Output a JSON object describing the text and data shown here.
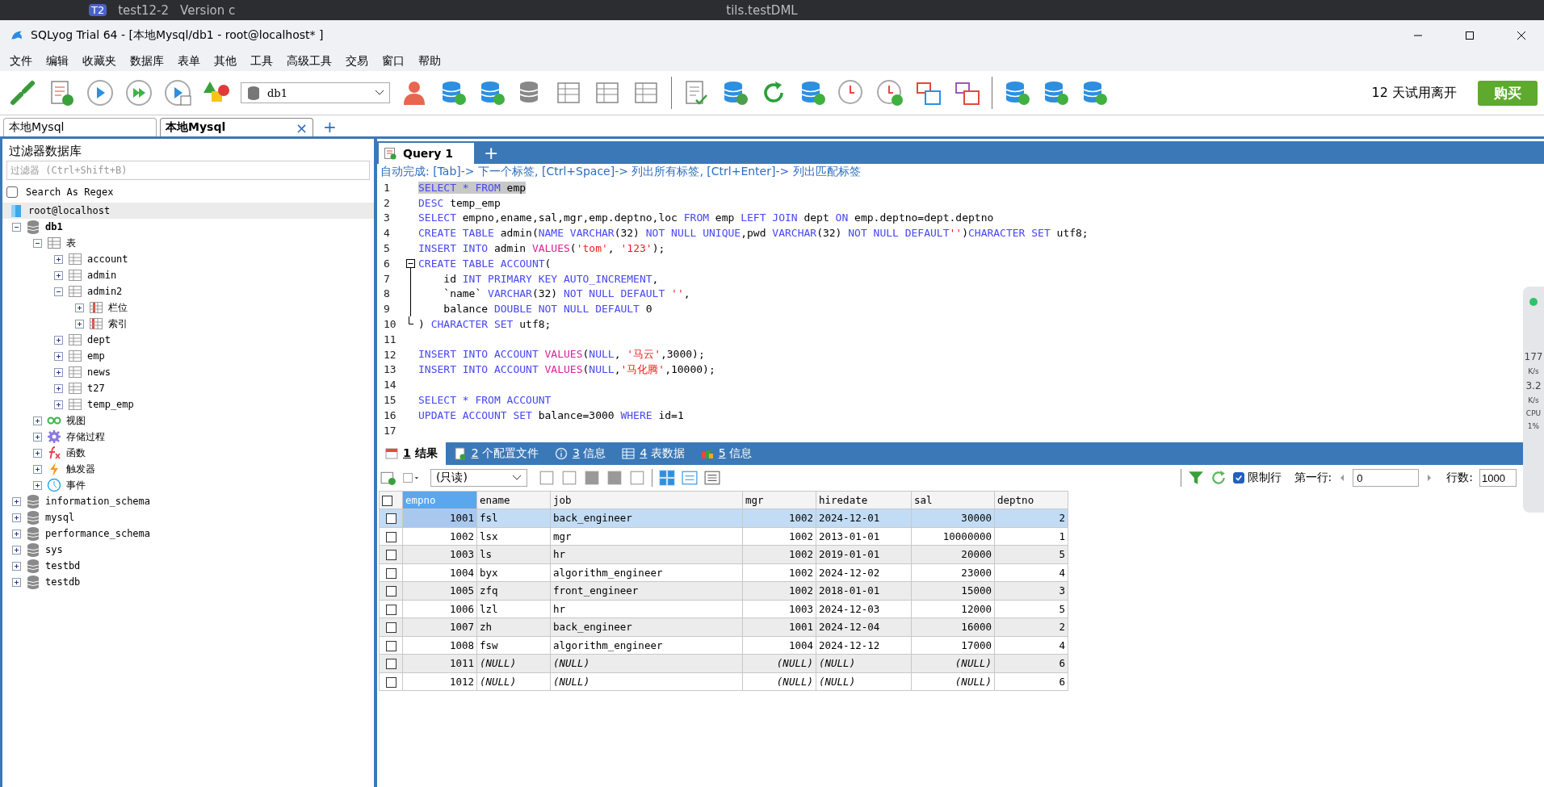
{
  "background_ide": {
    "project_badge": "T2",
    "project": "test12-2",
    "tab": "Version c",
    "run_config": "tils.testDML"
  },
  "window": {
    "title": "SQLyog Trial 64 - [本地Mysql/db1 - root@localhost* ]"
  },
  "menu": [
    "文件",
    "编辑",
    "收藏夹",
    "数据库",
    "表单",
    "其他",
    "工具",
    "高级工具",
    "交易",
    "窗口",
    "帮助"
  ],
  "toolbar": {
    "database_select": "db1",
    "trial_notice": "12 天试用离开",
    "buy_button": "购买"
  },
  "connection_tabs": [
    {
      "label": "本地Mysql",
      "selected": false
    },
    {
      "label": "本地Mysql",
      "selected": true,
      "close": "×"
    }
  ],
  "new_tab": "+",
  "sidebar": {
    "title": "过滤器数据库",
    "filter": {
      "placeholder": "过滤器 (Ctrl+Shift+B)"
    },
    "regex": {
      "label": "Search As Regex",
      "checked": false
    },
    "tree": {
      "label": "root@localhost",
      "kind": "server",
      "children": [
        {
          "label": "db1",
          "kind": "database",
          "current": true,
          "expanded": true,
          "children": [
            {
              "label": "表",
              "kind": "tables",
              "expanded": true,
              "children": [
                {
                  "label": "account",
                  "kind": "table",
                  "expanded": false
                },
                {
                  "label": "admin",
                  "kind": "table",
                  "expanded": false
                },
                {
                  "label": "admin2",
                  "kind": "table",
                  "expanded": true,
                  "children": [
                    {
                      "label": "栏位",
                      "kind": "columns",
                      "expanded": false
                    },
                    {
                      "label": "索引",
                      "kind": "indexes",
                      "expanded": false
                    }
                  ]
                },
                {
                  "label": "dept",
                  "kind": "table",
                  "expanded": false
                },
                {
                  "label": "emp",
                  "kind": "table",
                  "expanded": false
                },
                {
                  "label": "news",
                  "kind": "table",
                  "expanded": false
                },
                {
                  "label": "t27",
                  "kind": "table",
                  "expanded": false
                },
                {
                  "label": "temp_emp",
                  "kind": "table",
                  "expanded": false
                }
              ]
            },
            {
              "label": "视图",
              "kind": "views",
              "expanded": false
            },
            {
              "label": "存储过程",
              "kind": "procedures",
              "expanded": false
            },
            {
              "label": "函数",
              "kind": "functions",
              "expanded": false
            },
            {
              "label": "触发器",
              "kind": "triggers",
              "expanded": false
            },
            {
              "label": "事件",
              "kind": "events",
              "expanded": false
            }
          ]
        },
        {
          "label": "information_schema",
          "kind": "database",
          "current": false,
          "expanded": false
        },
        {
          "label": "mysql",
          "kind": "database",
          "current": false,
          "expanded": false
        },
        {
          "label": "performance_schema",
          "kind": "database",
          "current": false,
          "expanded": false
        },
        {
          "label": "sys",
          "kind": "database",
          "current": false,
          "expanded": false
        },
        {
          "label": "testbd",
          "kind": "database",
          "current": false,
          "expanded": false
        },
        {
          "label": "testdb",
          "kind": "database",
          "current": false,
          "expanded": false
        }
      ]
    }
  },
  "query_tabs": [
    {
      "label": "Query 1",
      "selected": true
    }
  ],
  "editor": {
    "hint": "自动完成: [Tab]-> 下一个标签, [Ctrl+Space]-> 列出所有标签, [Ctrl+Enter]-> 列出匹配标签",
    "lines": [
      {
        "number": "1",
        "selected": true,
        "segments": [
          {
            "kind": "kw",
            "text": "SELECT * FROM"
          },
          {
            "kind": "txt",
            "text": " emp"
          }
        ]
      },
      {
        "number": "2",
        "selected": false,
        "segments": [
          {
            "kind": "kw",
            "text": "DESC"
          },
          {
            "kind": "txt",
            "text": " temp_emp"
          }
        ]
      },
      {
        "number": "3",
        "selected": false,
        "segments": [
          {
            "kind": "kw",
            "text": "SELECT"
          },
          {
            "kind": "txt",
            "text": " empno,ename,sal,mgr,emp.deptno,loc "
          },
          {
            "kind": "kw",
            "text": "FROM"
          },
          {
            "kind": "txt",
            "text": " emp "
          },
          {
            "kind": "kw",
            "text": "LEFT JOIN"
          },
          {
            "kind": "txt",
            "text": " dept "
          },
          {
            "kind": "kw",
            "text": "ON"
          },
          {
            "kind": "txt",
            "text": " emp.deptno=dept.deptno"
          }
        ]
      },
      {
        "number": "4",
        "selected": false,
        "segments": [
          {
            "kind": "kw",
            "text": "CREATE TABLE"
          },
          {
            "kind": "txt",
            "text": " admin("
          },
          {
            "kind": "kw",
            "text": "NAME VARCHAR"
          },
          {
            "kind": "txt",
            "text": "(32) "
          },
          {
            "kind": "kw",
            "text": "NOT NULL UNIQUE"
          },
          {
            "kind": "txt",
            "text": ",pwd "
          },
          {
            "kind": "kw",
            "text": "VARCHAR"
          },
          {
            "kind": "txt",
            "text": "(32) "
          },
          {
            "kind": "kw",
            "text": "NOT NULL DEFAULT"
          },
          {
            "kind": "str",
            "text": "''"
          },
          {
            "kind": "txt",
            "text": ")"
          },
          {
            "kind": "kw",
            "text": "CHARACTER SET"
          },
          {
            "kind": "txt",
            "text": " utf8;"
          }
        ]
      },
      {
        "number": "5",
        "selected": false,
        "segments": [
          {
            "kind": "kw",
            "text": "INSERT INTO"
          },
          {
            "kind": "txt",
            "text": " admin "
          },
          {
            "kind": "fn",
            "text": "VALUES"
          },
          {
            "kind": "txt",
            "text": "("
          },
          {
            "kind": "str",
            "text": "'tom'"
          },
          {
            "kind": "txt",
            "text": ", "
          },
          {
            "kind": "str",
            "text": "'123'"
          },
          {
            "kind": "txt",
            "text": ");"
          }
        ]
      },
      {
        "number": "6",
        "selected": false,
        "kind": "fold_start",
        "segments": [
          {
            "kind": "kw",
            "text": "CREATE TABLE ACCOUNT"
          },
          {
            "kind": "txt",
            "text": "("
          }
        ]
      },
      {
        "number": "7",
        "selected": false,
        "kind": "fold_inner",
        "segments": [
          {
            "kind": "txt",
            "text": "    id "
          },
          {
            "kind": "kw",
            "text": "INT PRIMARY KEY AUTO_INCREMENT"
          },
          {
            "kind": "txt",
            "text": ","
          }
        ]
      },
      {
        "number": "8",
        "selected": false,
        "kind": "fold_inner",
        "segments": [
          {
            "kind": "txt",
            "text": "    `name` "
          },
          {
            "kind": "kw",
            "text": "VARCHAR"
          },
          {
            "kind": "txt",
            "text": "(32) "
          },
          {
            "kind": "kw",
            "text": "NOT NULL DEFAULT"
          },
          {
            "kind": "str",
            "text": " ''"
          },
          {
            "kind": "txt",
            "text": ","
          }
        ]
      },
      {
        "number": "9",
        "selected": false,
        "kind": "fold_inner",
        "segments": [
          {
            "kind": "txt",
            "text": "    balance "
          },
          {
            "kind": "kw",
            "text": "DOUBLE NOT NULL DEFAULT"
          },
          {
            "kind": "txt",
            "text": " 0"
          }
        ]
      },
      {
        "number": "10",
        "selected": false,
        "kind": "fold_end",
        "segments": [
          {
            "kind": "txt",
            "text": ") "
          },
          {
            "kind": "kw",
            "text": "CHARACTER SET"
          },
          {
            "kind": "txt",
            "text": " utf8;"
          }
        ]
      },
      {
        "number": "11",
        "selected": false
      },
      {
        "number": "12",
        "selected": false,
        "segments": [
          {
            "kind": "kw",
            "text": "INSERT INTO ACCOUNT"
          },
          {
            "kind": "fn",
            "text": " VALUES"
          },
          {
            "kind": "txt",
            "text": "("
          },
          {
            "kind": "kw",
            "text": "NULL"
          },
          {
            "kind": "txt",
            "text": ", "
          },
          {
            "kind": "str",
            "text": "'马云'"
          },
          {
            "kind": "txt",
            "text": ",3000);"
          }
        ]
      },
      {
        "number": "13",
        "selected": false,
        "segments": [
          {
            "kind": "kw",
            "text": "INSERT INTO ACCOUNT"
          },
          {
            "kind": "fn",
            "text": " VALUES"
          },
          {
            "kind": "txt",
            "text": "("
          },
          {
            "kind": "kw",
            "text": "NULL"
          },
          {
            "kind": "txt",
            "text": ","
          },
          {
            "kind": "str",
            "text": "'马化腾'"
          },
          {
            "kind": "txt",
            "text": ",10000);"
          }
        ]
      },
      {
        "number": "14",
        "selected": false
      },
      {
        "number": "15",
        "selected": false,
        "segments": [
          {
            "kind": "kw",
            "text": "SELECT * FROM ACCOUNT"
          }
        ]
      },
      {
        "number": "16",
        "selected": false,
        "segments": [
          {
            "kind": "kw",
            "text": "UPDATE ACCOUNT SET"
          },
          {
            "kind": "txt",
            "text": " balance=3000 "
          },
          {
            "kind": "kw",
            "text": "WHERE"
          },
          {
            "kind": "txt",
            "text": " id=1"
          }
        ]
      },
      {
        "number": "17",
        "selected": false
      }
    ]
  },
  "result_tabs": [
    {
      "number": "1",
      "label": "结果",
      "kind": "grid",
      "selected": true
    },
    {
      "number": "2",
      "label": "个配置文件",
      "kind": "profile",
      "selected": false
    },
    {
      "number": "3",
      "label": "信息",
      "kind": "info",
      "selected": false
    },
    {
      "number": "4",
      "label": "表数据",
      "kind": "table",
      "selected": false
    },
    {
      "number": "5",
      "label": "信息",
      "kind": "history",
      "selected": false
    }
  ],
  "result_toolbar": {
    "mode": "(只读)",
    "limit": {
      "label": "限制行",
      "checked": true
    },
    "first_row_label": "第一行:",
    "first_row": "0",
    "row_count_label": "行数:",
    "row_count": "1000"
  },
  "table": {
    "all_checked": false,
    "columns": [
      {
        "label": "empno",
        "kind": "number",
        "selected": true
      },
      {
        "label": "ename",
        "kind": "text",
        "selected": false
      },
      {
        "label": "job",
        "kind": "text",
        "selected": false
      },
      {
        "label": "mgr",
        "kind": "number",
        "selected": false
      },
      {
        "label": "hiredate",
        "kind": "text",
        "selected": false
      },
      {
        "label": "sal",
        "kind": "number",
        "selected": false
      },
      {
        "label": "deptno",
        "kind": "number",
        "selected": false
      }
    ],
    "rows": [
      {
        "selected": true,
        "checked": false,
        "cells": [
          "1001",
          "fsl",
          "back_engineer",
          "1002",
          "2024-12-01",
          "30000",
          "2"
        ]
      },
      {
        "selected": false,
        "checked": false,
        "cells": [
          "1002",
          "lsx",
          "mgr",
          "1002",
          "2013-01-01",
          "10000000",
          "1"
        ]
      },
      {
        "selected": false,
        "checked": false,
        "cells": [
          "1003",
          "ls",
          "hr",
          "1002",
          "2019-01-01",
          "20000",
          "5"
        ]
      },
      {
        "selected": false,
        "checked": false,
        "cells": [
          "1004",
          "byx",
          "algorithm_engineer",
          "1002",
          "2024-12-02",
          "23000",
          "4"
        ]
      },
      {
        "selected": false,
        "checked": false,
        "cells": [
          "1005",
          "zfq",
          "front_engineer",
          "1002",
          "2018-01-01",
          "15000",
          "3"
        ]
      },
      {
        "selected": false,
        "checked": false,
        "cells": [
          "1006",
          "lzl",
          "hr",
          "1003",
          "2024-12-03",
          "12000",
          "5"
        ]
      },
      {
        "selected": false,
        "checked": false,
        "cells": [
          "1007",
          "zh",
          "back_engineer",
          "1001",
          "2024-12-04",
          "16000",
          "2"
        ]
      },
      {
        "selected": false,
        "checked": false,
        "cells": [
          "1008",
          "fsw",
          "algorithm_engineer",
          "1004",
          "2024-12-12",
          "17000",
          "4"
        ]
      },
      {
        "selected": false,
        "checked": false,
        "cells": [
          "1011",
          {
            "text": "(NULL)",
            "null": true
          },
          {
            "text": "(NULL)",
            "null": true
          },
          {
            "text": "(NULL)",
            "null": true
          },
          {
            "text": "(NULL)",
            "null": true
          },
          {
            "text": "(NULL)",
            "null": true
          },
          "6"
        ]
      },
      {
        "selected": false,
        "checked": false,
        "cells": [
          "1012",
          {
            "text": "(NULL)",
            "null": true
          },
          {
            "text": "(NULL)",
            "null": true
          },
          {
            "text": "(NULL)",
            "null": true
          },
          {
            "text": "(NULL)",
            "null": true
          },
          {
            "text": "(NULL)",
            "null": true
          },
          "6"
        ]
      }
    ]
  },
  "monitor": {
    "upload": "177",
    "upload_unit": "K/s",
    "download": "3.2",
    "download_unit": "K/s",
    "cpu_label": "CPU",
    "cpu": "1%"
  }
}
